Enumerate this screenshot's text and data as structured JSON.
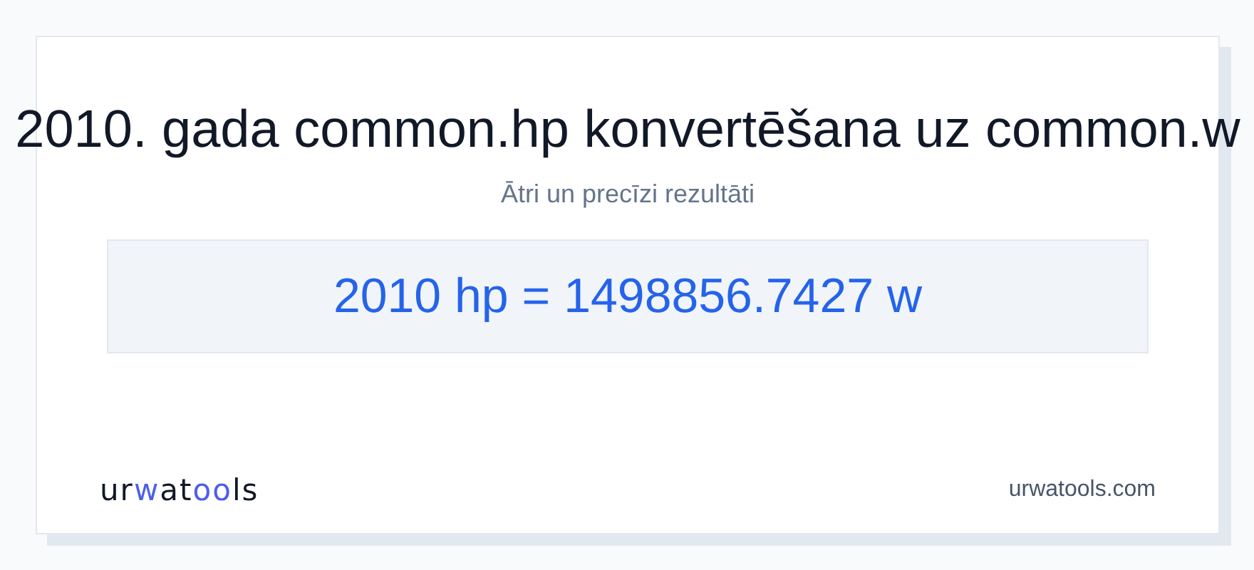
{
  "title": "2010. gada common.hp konvertēšana uz common.w",
  "subtitle": "Ātri un precīzi rezultāti",
  "result": "2010 hp = 1498856.7427 w",
  "logo": [
    {
      "text": "ur",
      "accent": false
    },
    {
      "text": "w",
      "accent": true
    },
    {
      "text": "at",
      "accent": false
    },
    {
      "text": "oo",
      "accent": true
    },
    {
      "text": "ls",
      "accent": false
    }
  ],
  "site": "urwatools.com"
}
